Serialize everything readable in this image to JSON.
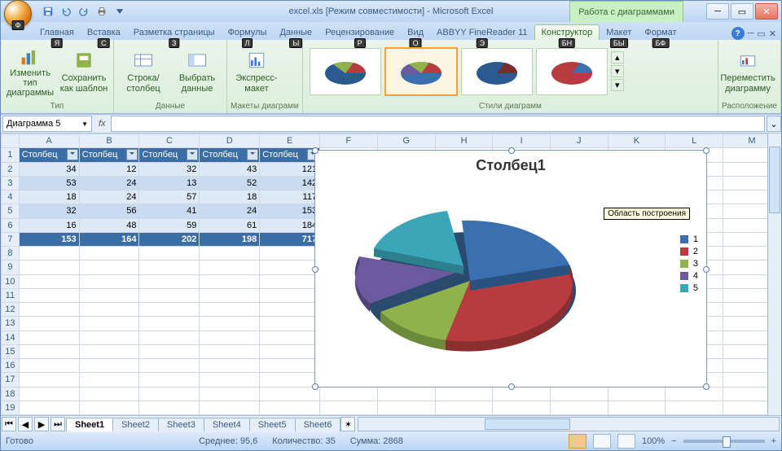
{
  "title": "excel.xls [Режим совместимости] - Microsoft Excel",
  "chart_tools_label": "Работа с диаграммами",
  "tabs": {
    "home": "Главная",
    "insert": "Вставка",
    "layout": "Разметка страницы",
    "formulas": "Формулы",
    "data": "Данные",
    "review": "Рецензирование",
    "view": "Вид",
    "abbyy": "ABBYY FineReader 11",
    "design": "Конструктор",
    "layout2": "Макет",
    "format": "Формат"
  },
  "keytips": {
    "office": "Ф",
    "home": "Я",
    "insert": "С",
    "layout": "З",
    "formulas": "Л",
    "data": "Ы",
    "review": "Р",
    "view": "О",
    "abbyy": "Э",
    "design": "БН",
    "layout2": "БЫ",
    "format": "БФ"
  },
  "ribbon": {
    "type_group": "Тип",
    "change_type": "Изменить тип диаграммы",
    "save_template": "Сохранить как шаблон",
    "data_group": "Данные",
    "switch": "Строка/столбец",
    "select": "Выбрать данные",
    "layouts_group": "Макеты диаграмм",
    "express": "Экспресс-макет",
    "styles_group": "Стили диаграмм",
    "location_group": "Расположение",
    "move": "Переместить диаграмму"
  },
  "namebox": "Диаграмма 5",
  "columns": [
    "A",
    "B",
    "C",
    "D",
    "E",
    "F",
    "G",
    "H",
    "I",
    "J",
    "K",
    "L",
    "M"
  ],
  "headers": [
    "Столбец1",
    "Столбец2",
    "Столбец3",
    "Столбец4",
    "Столбец5"
  ],
  "rows": [
    [
      34,
      12,
      32,
      43,
      121
    ],
    [
      53,
      24,
      13,
      52,
      142
    ],
    [
      18,
      24,
      57,
      18,
      117
    ],
    [
      32,
      56,
      41,
      24,
      153
    ],
    [
      16,
      48,
      59,
      61,
      184
    ]
  ],
  "totals": [
    153,
    164,
    202,
    198,
    717
  ],
  "chart_data": {
    "type": "pie",
    "title": "Столбец1",
    "categories": [
      "1",
      "2",
      "3",
      "4",
      "5"
    ],
    "values": [
      34,
      53,
      18,
      32,
      16
    ],
    "colors": [
      "#3a6fb0",
      "#b83c3f",
      "#8fb24b",
      "#6b5a9e",
      "#3aa6b8"
    ],
    "tooltip": "Область построения"
  },
  "sheets": [
    "Sheet1",
    "Sheet2",
    "Sheet3",
    "Sheet4",
    "Sheet5",
    "Sheet6"
  ],
  "status": {
    "ready": "Готово",
    "avg": "Среднее: 95,6",
    "count": "Количество: 35",
    "sum": "Сумма: 2868",
    "zoom": "100%"
  }
}
